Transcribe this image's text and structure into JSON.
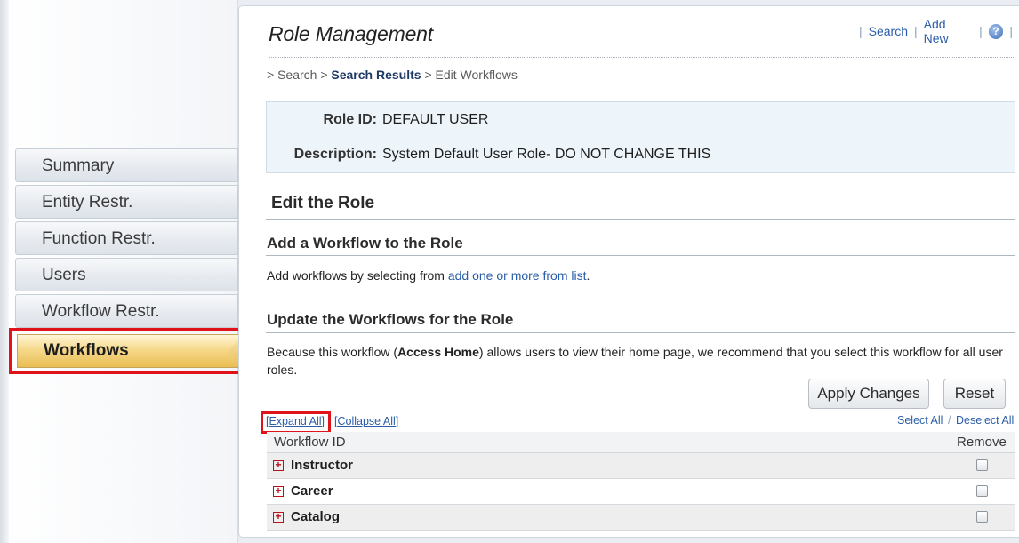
{
  "sidebar": {
    "items": [
      {
        "label": "Summary"
      },
      {
        "label": "Entity Restr."
      },
      {
        "label": "Function Restr."
      },
      {
        "label": "Users"
      },
      {
        "label": "Workflow Restr."
      }
    ],
    "active_label": "Workflows"
  },
  "header": {
    "title": "Role Management",
    "links": {
      "search": "Search",
      "add_new": "Add New",
      "help": "?"
    }
  },
  "breadcrumb": {
    "search": "> Search >",
    "results": "Search Results",
    "current": "> Edit Workflows"
  },
  "role": {
    "id_label": "Role ID:",
    "id_value": "DEFAULT USER",
    "desc_label": "Description:",
    "desc_value": "System Default User Role- DO NOT CHANGE THIS"
  },
  "edit": {
    "heading": "Edit the Role",
    "add_heading": "Add a Workflow to the Role",
    "add_text": "Add workflows by selecting from",
    "add_link": "add one or more from list",
    "add_text_end": ".",
    "update_heading": "Update the Workflows for the Role",
    "note_pre": "Because this workflow (",
    "note_bold": "Access Home",
    "note_post": ") allows users to view their home page, we recommend that you select this workflow for all user roles."
  },
  "buttons": {
    "apply": "Apply Changes",
    "reset": "Reset"
  },
  "links": {
    "expand_all": "[Expand All]",
    "collapse_all": "[Collapse All]",
    "select_all": "Select All",
    "separator": "/",
    "deselect_all": "Deselect All"
  },
  "table": {
    "col_workflow": "Workflow ID",
    "col_remove": "Remove",
    "rows": [
      {
        "name": "Instructor",
        "checked": false
      },
      {
        "name": "Career",
        "checked": false
      },
      {
        "name": "Catalog",
        "checked": false
      }
    ]
  },
  "colors": {
    "highlight": "#e0121a",
    "link": "#2a5ea8",
    "active_tab": "#f6d98c"
  }
}
